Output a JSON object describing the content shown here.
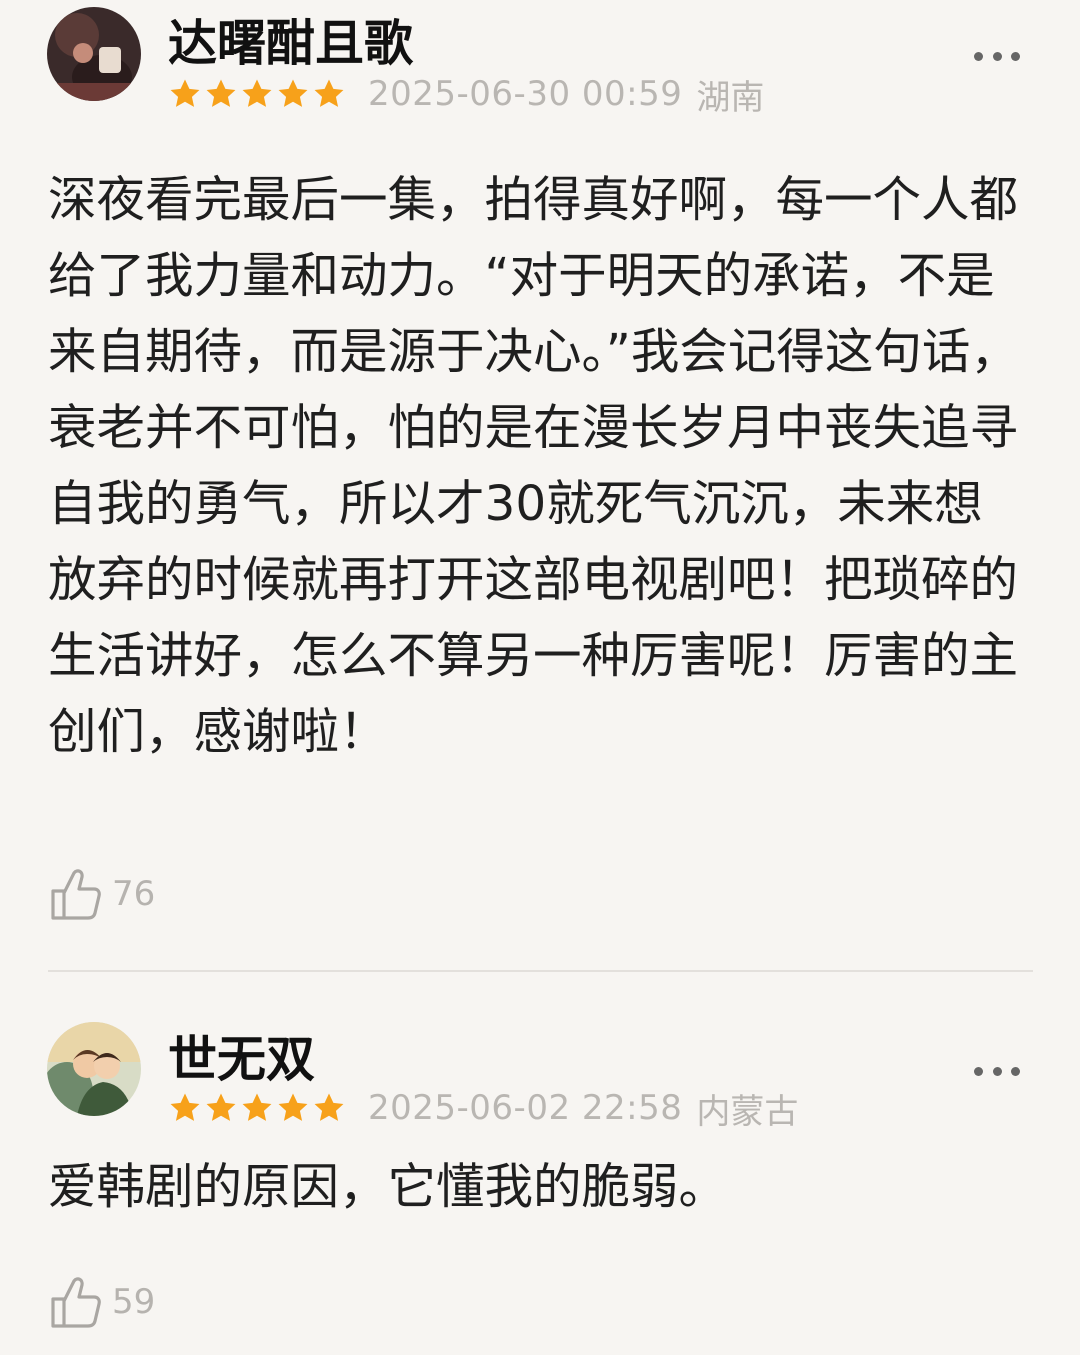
{
  "comments": [
    {
      "username": "达曙酣且歌",
      "rating": 5,
      "timestamp": "2025-06-30 00:59",
      "location": "湖南",
      "text": "深夜看完最后一集，拍得真好啊，每一个人都给了我力量和动力。“对于明天的承诺，不是来自期待，而是源于决心。”我会记得这句话，衰老并不可怕，怕的是在漫长岁月中丧失追寻自我的勇气，所以才30就死气沉沉，未来想放弃的时候就再打开这部电视剧吧！把琐碎的生活讲好，怎么不算另一种厉害呢！厉害的主创们，感谢啦！",
      "likes": "76"
    },
    {
      "username": "世无双",
      "rating": 5,
      "timestamp": "2025-06-02 22:58",
      "location": "内蒙古",
      "text": "爱韩剧的原因，它懂我的脆弱。",
      "likes": "59"
    }
  ],
  "colors": {
    "background": "#f7f5f2",
    "star": "#f7a11a",
    "meta_text": "#b9b6b2",
    "divider": "#e3e0dc"
  },
  "icons": {
    "rating": "star-icon",
    "more": "more-dots-icon",
    "like": "thumbs-up-icon"
  }
}
